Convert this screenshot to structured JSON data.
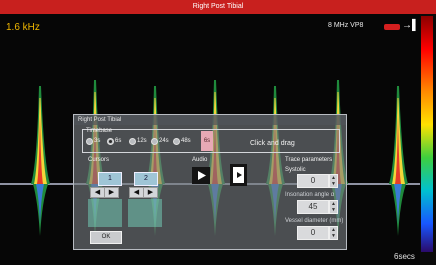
{
  "app": {
    "title": "Right Post Tibial"
  },
  "display": {
    "scale": "1.6 kHz",
    "probe": "8 MHz VP8",
    "time": "6secs",
    "colors": {
      "title_bar": "#c8201e",
      "scale": "#f0b700",
      "baseline": "#dfe7ff"
    }
  },
  "dialog": {
    "title": "Right Post Tibial",
    "timebase": {
      "label": "Timebase",
      "options": [
        "3s",
        "6s",
        "12s",
        "24s",
        "48s"
      ],
      "selected_option": "6s",
      "selected": "6s"
    },
    "hint": "Click and drag",
    "cursors": {
      "label": "Cursors",
      "one": "1",
      "two": "2"
    },
    "audio": "Audio",
    "trace": {
      "label": "Trace parameters",
      "systolic_label": "Systolic",
      "systolic_value": "0",
      "angle_label": "Insonation angle α",
      "angle_value": "45",
      "diameter_label": "Vessel diameter (mm)",
      "diameter_value": "0"
    },
    "ok": "OK"
  }
}
